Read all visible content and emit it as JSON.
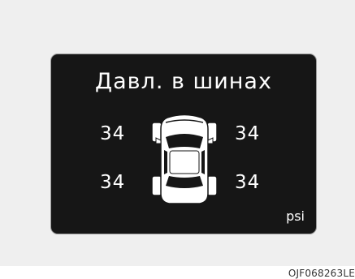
{
  "display": {
    "title": "Давл. в шинах",
    "unit": "psi",
    "tires": {
      "front_left": "34",
      "front_right": "34",
      "rear_left": "34",
      "rear_right": "34"
    }
  },
  "image_code": "OJF068263LE",
  "colors": {
    "display_background": "#161616",
    "text": "#ffffff",
    "panel_background": "#efefef"
  },
  "icons": {
    "car": "car-top-view-icon"
  }
}
